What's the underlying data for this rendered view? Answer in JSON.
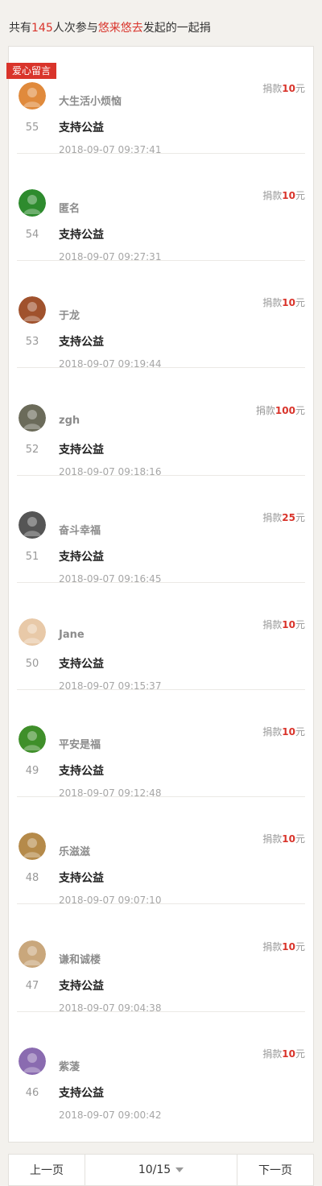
{
  "summary": {
    "prefix": "共有",
    "count": "145",
    "middle": "人次参与",
    "initiator": "悠来悠去",
    "suffix": "发起的一起捐"
  },
  "tag_label": "爱心留言",
  "amount_prefix": "捐款",
  "amount_suffix": "元",
  "entries": [
    {
      "rank": "55",
      "name": "大生活小烦恼",
      "message": "支持公益",
      "time": "2018-09-07 09:37:41",
      "amount": "10",
      "avatar_color": "#e08a3c",
      "avatar_icon": "cartoon-character-avatar-icon"
    },
    {
      "rank": "54",
      "name": "匿名",
      "message": "支持公益",
      "time": "2018-09-07 09:27:31",
      "amount": "10",
      "avatar_color": "#2e8b2e",
      "avatar_icon": "penguin-avatar-icon"
    },
    {
      "rank": "53",
      "name": "于龙",
      "message": "支持公益",
      "time": "2018-09-07 09:19:44",
      "amount": "10",
      "avatar_color": "#a0522d",
      "avatar_icon": "sunset-avatar-icon"
    },
    {
      "rank": "52",
      "name": "zgh",
      "message": "支持公益",
      "time": "2018-09-07 09:18:16",
      "amount": "100",
      "avatar_color": "#6b6b5a",
      "avatar_icon": "photo-avatar-icon"
    },
    {
      "rank": "51",
      "name": "奋斗幸福",
      "message": "支持公益",
      "time": "2018-09-07 09:16:45",
      "amount": "25",
      "avatar_color": "#555555",
      "avatar_icon": "grayscale-photo-avatar-icon"
    },
    {
      "rank": "50",
      "name": "Jane",
      "message": "支持公益",
      "time": "2018-09-07 09:15:37",
      "amount": "10",
      "avatar_color": "#e8c9a8",
      "avatar_icon": "portrait-avatar-icon"
    },
    {
      "rank": "49",
      "name": "平安是福",
      "message": "支持公益",
      "time": "2018-09-07 09:12:48",
      "amount": "10",
      "avatar_color": "#3f8f2a",
      "avatar_icon": "green-plant-avatar-icon"
    },
    {
      "rank": "48",
      "name": "乐滋滋",
      "message": "支持公益",
      "time": "2018-09-07 09:07:10",
      "amount": "10",
      "avatar_color": "#b58a4a",
      "avatar_icon": "landscape-avatar-icon"
    },
    {
      "rank": "47",
      "name": "谦和诚楼",
      "message": "支持公益",
      "time": "2018-09-07 09:04:38",
      "amount": "10",
      "avatar_color": "#c9a77c",
      "avatar_icon": "interior-photo-avatar-icon"
    },
    {
      "rank": "46",
      "name": "紫蓤",
      "message": "支持公益",
      "time": "2018-09-07 09:00:42",
      "amount": "10",
      "avatar_color": "#8a6bb0",
      "avatar_icon": "purple-flower-avatar-icon"
    }
  ],
  "pager": {
    "prev_label": "上一页",
    "page_indicator": "10/15",
    "next_label": "下一页"
  }
}
